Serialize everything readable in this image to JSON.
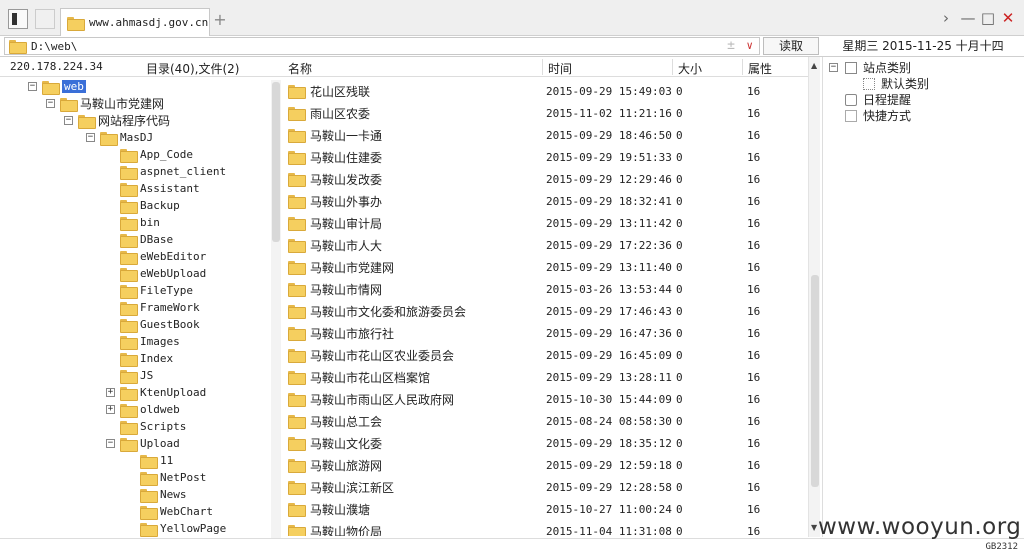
{
  "titlebar": {
    "tab_title": "www.ahmasdj.gov.cn",
    "new_tab": "+",
    "back_glyph": "›",
    "minimize_glyph": "—",
    "maximize_glyph": "□",
    "close_glyph": "✕"
  },
  "address": {
    "path": "D:\\web\\",
    "add_glyph": "±",
    "dropdown_glyph": "∨",
    "read_button": "读取",
    "date": "星期三 2015-11-25 十月十四"
  },
  "left": {
    "ip": "220.178.224.34",
    "counts": "目录(40),文件(2)"
  },
  "tree": [
    {
      "label": "web",
      "level": 0,
      "toggle": "−",
      "selected": true,
      "cn": false
    },
    {
      "label": "马鞍山市党建网",
      "level": 1,
      "toggle": "−",
      "cn": true
    },
    {
      "label": "网站程序代码",
      "level": 2,
      "toggle": "−",
      "cn": true
    },
    {
      "label": "MasDJ",
      "level": 3,
      "toggle": "−",
      "cn": false
    },
    {
      "label": "App_Code",
      "level": 4,
      "toggle": "",
      "cn": false
    },
    {
      "label": "aspnet_client",
      "level": 4,
      "toggle": "",
      "cn": false
    },
    {
      "label": "Assistant",
      "level": 4,
      "toggle": "",
      "cn": false
    },
    {
      "label": "Backup",
      "level": 4,
      "toggle": "",
      "cn": false
    },
    {
      "label": "bin",
      "level": 4,
      "toggle": "",
      "cn": false
    },
    {
      "label": "DBase",
      "level": 4,
      "toggle": "",
      "cn": false
    },
    {
      "label": "eWebEditor",
      "level": 4,
      "toggle": "",
      "cn": false
    },
    {
      "label": "eWebUpload",
      "level": 4,
      "toggle": "",
      "cn": false
    },
    {
      "label": "FileType",
      "level": 4,
      "toggle": "",
      "cn": false
    },
    {
      "label": "FrameWork",
      "level": 4,
      "toggle": "",
      "cn": false
    },
    {
      "label": "GuestBook",
      "level": 4,
      "toggle": "",
      "cn": false
    },
    {
      "label": "Images",
      "level": 4,
      "toggle": "",
      "cn": false
    },
    {
      "label": "Index",
      "level": 4,
      "toggle": "",
      "cn": false
    },
    {
      "label": "JS",
      "level": 4,
      "toggle": "",
      "cn": false
    },
    {
      "label": "KtenUpload",
      "level": 4,
      "toggle": "+",
      "cn": false
    },
    {
      "label": "oldweb",
      "level": 4,
      "toggle": "+",
      "cn": false
    },
    {
      "label": "Scripts",
      "level": 4,
      "toggle": "",
      "cn": false
    },
    {
      "label": "Upload",
      "level": 4,
      "toggle": "−",
      "cn": false
    },
    {
      "label": "11",
      "level": 5,
      "toggle": "",
      "cn": false
    },
    {
      "label": "NetPost",
      "level": 5,
      "toggle": "",
      "cn": false
    },
    {
      "label": "News",
      "level": 5,
      "toggle": "",
      "cn": false
    },
    {
      "label": "WebChart",
      "level": 5,
      "toggle": "",
      "cn": false
    },
    {
      "label": "YellowPage",
      "level": 5,
      "toggle": "",
      "cn": false
    }
  ],
  "filelist": {
    "headers": {
      "name": "名称",
      "time": "时间",
      "size": "大小",
      "attr": "属性"
    },
    "rows": [
      {
        "name": "花山区残联",
        "time": "2015-09-29 15:49:03",
        "size": "0",
        "attr": "16"
      },
      {
        "name": "雨山区农委",
        "time": "2015-11-02 11:21:16",
        "size": "0",
        "attr": "16"
      },
      {
        "name": "马鞍山一卡通",
        "time": "2015-09-29 18:46:50",
        "size": "0",
        "attr": "16"
      },
      {
        "name": "马鞍山住建委",
        "time": "2015-09-29 19:51:33",
        "size": "0",
        "attr": "16"
      },
      {
        "name": "马鞍山发改委",
        "time": "2015-09-29 12:29:46",
        "size": "0",
        "attr": "16"
      },
      {
        "name": "马鞍山外事办",
        "time": "2015-09-29 18:32:41",
        "size": "0",
        "attr": "16"
      },
      {
        "name": "马鞍山审计局",
        "time": "2015-09-29 13:11:42",
        "size": "0",
        "attr": "16"
      },
      {
        "name": "马鞍山市人大",
        "time": "2015-09-29 17:22:36",
        "size": "0",
        "attr": "16"
      },
      {
        "name": "马鞍山市党建网",
        "time": "2015-09-29 13:11:40",
        "size": "0",
        "attr": "16"
      },
      {
        "name": "马鞍山市情网",
        "time": "2015-03-26 13:53:44",
        "size": "0",
        "attr": "16"
      },
      {
        "name": "马鞍山市文化委和旅游委员会",
        "time": "2015-09-29 17:46:43",
        "size": "0",
        "attr": "16"
      },
      {
        "name": "马鞍山市旅行社",
        "time": "2015-09-29 16:47:36",
        "size": "0",
        "attr": "16"
      },
      {
        "name": "马鞍山市花山区农业委员会",
        "time": "2015-09-29 16:45:09",
        "size": "0",
        "attr": "16"
      },
      {
        "name": "马鞍山市花山区档案馆",
        "time": "2015-09-29 13:28:11",
        "size": "0",
        "attr": "16"
      },
      {
        "name": "马鞍山市雨山区人民政府网",
        "time": "2015-10-30 15:44:09",
        "size": "0",
        "attr": "16"
      },
      {
        "name": "马鞍山总工会",
        "time": "2015-08-24 08:58:30",
        "size": "0",
        "attr": "16"
      },
      {
        "name": "马鞍山文化委",
        "time": "2015-09-29 18:35:12",
        "size": "0",
        "attr": "16"
      },
      {
        "name": "马鞍山旅游网",
        "time": "2015-09-29 12:59:18",
        "size": "0",
        "attr": "16"
      },
      {
        "name": "马鞍山滨江新区",
        "time": "2015-09-29 12:28:58",
        "size": "0",
        "attr": "16"
      },
      {
        "name": "马鞍山濮塘",
        "time": "2015-10-27 11:00:24",
        "size": "0",
        "attr": "16"
      },
      {
        "name": "马鞍山物价局",
        "time": "2015-11-04 11:31:08",
        "size": "0",
        "attr": "16"
      }
    ]
  },
  "rightpanel": {
    "root": "站点类别",
    "default_category": "默认类别",
    "schedule": "日程提醒",
    "shortcuts": "快捷方式"
  },
  "status": {
    "watermark": "www.wooyun.org",
    "encoding": "GB2312"
  },
  "colors": {
    "selection": "#3a6fd8",
    "folder": "#f5cf5f",
    "close": "#cc2222"
  }
}
